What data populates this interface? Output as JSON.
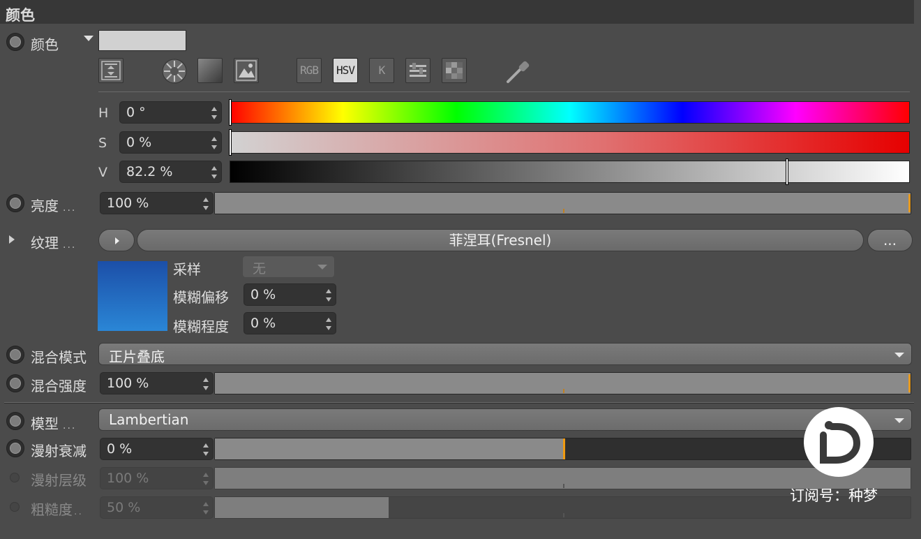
{
  "panel": {
    "header_title": "颜色",
    "color_label": "颜色",
    "hsv": {
      "h_label": "H",
      "h_value": "0 °",
      "s_label": "S",
      "s_value": "0 %",
      "v_label": "V",
      "v_value": "82.2 %"
    },
    "toolbar": {
      "rgb": "RGB",
      "hsv": "HSV",
      "k": "K"
    },
    "brightness": {
      "label": "亮度",
      "dots": "...",
      "value": "100 %",
      "level": 1.0
    },
    "texture": {
      "label": "纹理",
      "dots": "...",
      "shader_name": "菲涅耳(Fresnel)",
      "more_label": "...",
      "sample_label": "采样",
      "sample_value": "无",
      "blur_offset_label": "模糊偏移",
      "blur_offset_value": "0 %",
      "blur_scale_label": "模糊程度",
      "blur_scale_value": "0 %"
    },
    "blend_mode": {
      "label": "混合模式",
      "value": "正片叠底"
    },
    "blend_strength": {
      "label": "混合强度",
      "value": "100 %",
      "level": 1.0
    },
    "model": {
      "label": "模型",
      "dots": "...",
      "value": "Lambertian"
    },
    "diffuse_falloff": {
      "label": "漫射衰减",
      "value": "0 %",
      "level": 0.5
    },
    "diffuse_level": {
      "label": "漫射层级",
      "value": "100 %",
      "level": 1.0
    },
    "roughness": {
      "label": "粗糙度",
      "dots": "..",
      "value": "50 %",
      "level": 0.25
    }
  },
  "watermark": {
    "text": "订阅号：种梦",
    "logo_letters": "iD"
  },
  "colors": {
    "swatch": "#d1d1d1",
    "accent": "#e89a1e",
    "texture_preview_top": "#1c4fa8",
    "texture_preview_bottom": "#2a86d6"
  }
}
